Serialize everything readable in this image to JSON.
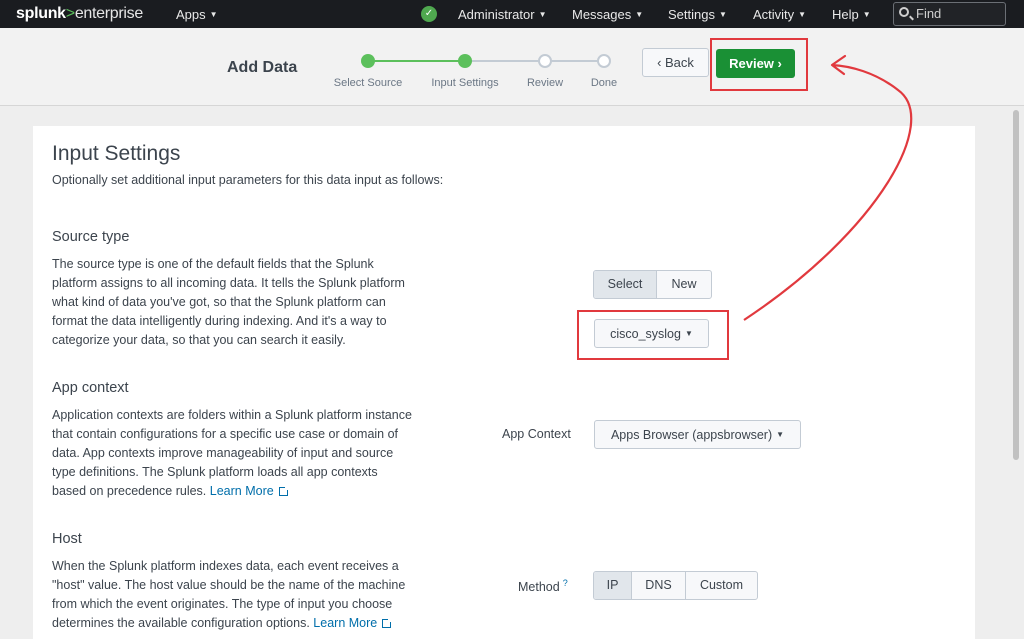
{
  "topbar": {
    "logo": {
      "brand": "splunk",
      "sep": ">",
      "product": "enterprise"
    },
    "apps": "Apps",
    "user": "Administrator",
    "messages": "Messages",
    "settings": "Settings",
    "activity": "Activity",
    "help": "Help",
    "find_placeholder": "Find"
  },
  "wizard": {
    "title": "Add Data",
    "steps": [
      {
        "label": "Select Source",
        "state": "done"
      },
      {
        "label": "Input Settings",
        "state": "done"
      },
      {
        "label": "Review",
        "state": "todo"
      },
      {
        "label": "Done",
        "state": "todo"
      }
    ],
    "back_label": "Back",
    "review_label": "Review"
  },
  "main": {
    "title": "Input Settings",
    "intro": "Optionally set additional input parameters for this data input as follows:",
    "source_type": {
      "title": "Source type",
      "lines": [
        "The source type is one of the default fields that the Splunk",
        "platform assigns to all incoming data. It tells the Splunk platform",
        "what kind of data you've got, so that the Splunk platform can",
        "format the data intelligently during indexing. And it's a way to",
        "categorize your data, so that you can search it easily."
      ],
      "select_label": "Select",
      "new_label": "New",
      "value": "cisco_syslog"
    },
    "app_context": {
      "title": "App context",
      "lines": [
        "Application contexts are folders within a Splunk platform instance",
        "that contain configurations for a specific use case or domain of",
        "data. App contexts improve manageability of input and source",
        "type definitions. The Splunk platform loads all app contexts",
        "based on precedence rules."
      ],
      "learn_more": "Learn More",
      "field_label": "App Context",
      "value": "Apps Browser (appsbrowser)"
    },
    "host": {
      "title": "Host",
      "lines": [
        "When the Splunk platform indexes data, each event receives a",
        "\"host\" value. The host value should be the name of the machine",
        "from which the event originates. The type of input you choose",
        "determines the available configuration options."
      ],
      "learn_more": "Learn More",
      "field_label": "Method",
      "help_mark": "?",
      "options": [
        "IP",
        "DNS",
        "Custom"
      ]
    }
  },
  "colors": {
    "accent_green": "#1a9035",
    "highlight_red": "#e1393e",
    "link_blue": "#006eaa"
  }
}
